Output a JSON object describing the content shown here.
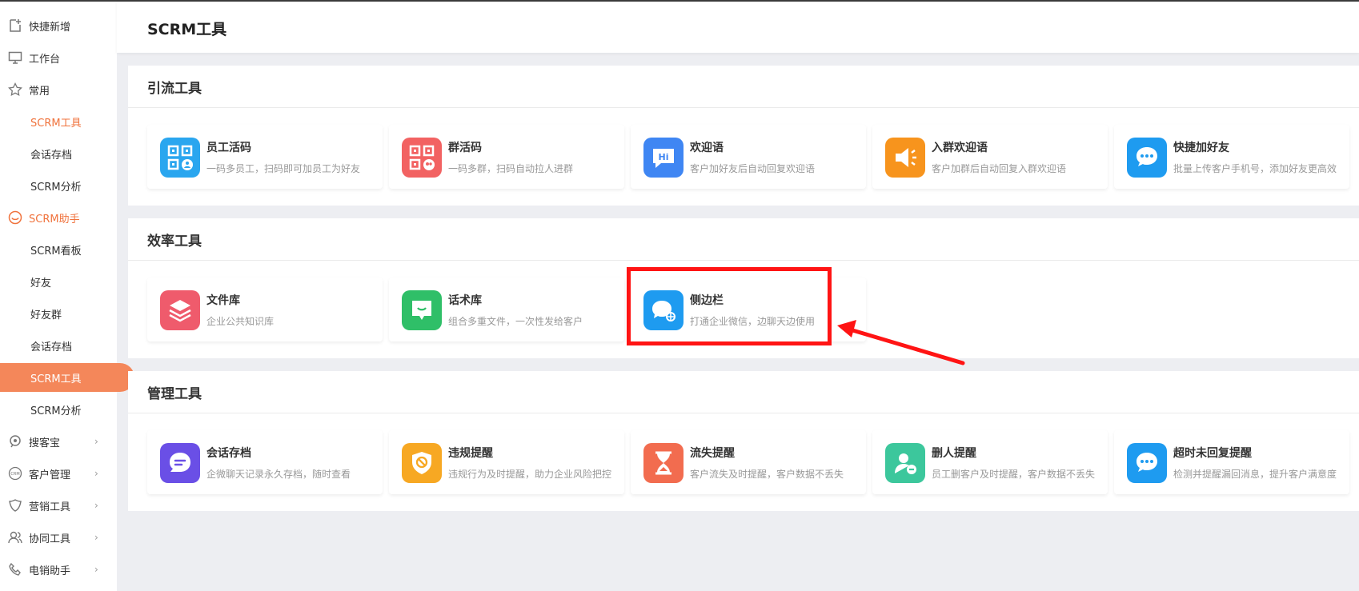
{
  "header": {
    "title": "SCRM工具"
  },
  "sidebar": {
    "items": [
      {
        "label": "快捷新增",
        "icon": "add-doc-icon"
      },
      {
        "label": "工作台",
        "icon": "monitor-icon"
      },
      {
        "label": "常用",
        "icon": "star-icon"
      },
      {
        "label": "SCRM工具"
      },
      {
        "label": "会话存档"
      },
      {
        "label": "SCRM分析"
      },
      {
        "label": "SCRM助手",
        "icon": "smile-icon"
      },
      {
        "label": "SCRM看板"
      },
      {
        "label": "好友"
      },
      {
        "label": "好友群"
      },
      {
        "label": "会话存档"
      },
      {
        "label": "SCRM工具"
      },
      {
        "label": "SCRM分析"
      },
      {
        "label": "搜客宝",
        "icon": "search-gear-icon"
      },
      {
        "label": "客户管理",
        "icon": "crm-icon"
      },
      {
        "label": "营销工具",
        "icon": "shield-heart-icon"
      },
      {
        "label": "协同工具",
        "icon": "users-icon"
      },
      {
        "label": "电销助手",
        "icon": "phone-icon"
      }
    ],
    "arrow": "›"
  },
  "sections": [
    {
      "title": "引流工具",
      "cards": [
        {
          "name": "员工活码",
          "desc": "一码多员工，扫码即可加员工为好友",
          "icon": "qrcode-user-icon",
          "color": "#2aa6ef"
        },
        {
          "name": "群活码",
          "desc": "一码多群，扫码自动拉人进群",
          "icon": "qrcode-group-icon",
          "color": "#f26262"
        },
        {
          "name": "欢迎语",
          "desc": "客户加好友后自动回复欢迎语",
          "icon": "hi-bubble-icon",
          "color": "#3f86f3"
        },
        {
          "name": "入群欢迎语",
          "desc": "客户加群后自动回复入群欢迎语",
          "icon": "megaphone-icon",
          "color": "#f7941d"
        },
        {
          "name": "快捷加好友",
          "desc": "批量上传客户手机号，添加好友更高效",
          "icon": "chat-dots-icon",
          "color": "#1e9bf0"
        }
      ]
    },
    {
      "title": "效率工具",
      "cards": [
        {
          "name": "文件库",
          "desc": "企业公共知识库",
          "icon": "layers-icon",
          "color": "#ef5b6c"
        },
        {
          "name": "话术库",
          "desc": "组合多重文件，一次性发给客户",
          "icon": "smile-chat-icon",
          "color": "#2fbf68"
        },
        {
          "name": "侧边栏",
          "desc": "打通企业微信，边聊天边使用",
          "icon": "chat-sidebar-icon",
          "color": "#1e9bf0"
        }
      ]
    },
    {
      "title": "管理工具",
      "cards": [
        {
          "name": "会话存档",
          "desc": "企微聊天记录永久存档，随时查看",
          "icon": "chat-lines-icon",
          "color": "#6a4fe6"
        },
        {
          "name": "违规提醒",
          "desc": "违规行为及时提醒，助力企业风险把控",
          "icon": "forbid-shield-icon",
          "color": "#f7a823"
        },
        {
          "name": "流失提醒",
          "desc": "客户流失及时提醒，客户数据不丢失",
          "icon": "hourglass-icon",
          "color": "#f26c4f"
        },
        {
          "name": "删人提醒",
          "desc": "员工删客户及时提醒，客户数据不丢失",
          "icon": "user-minus-icon",
          "color": "#3cc79c"
        },
        {
          "name": "超时未回复提醒",
          "desc": "检测并提醒漏回消息，提升客户满意度",
          "icon": "chat-dots-icon",
          "color": "#1e9bf0"
        }
      ]
    }
  ],
  "colors": {
    "accent": "#f4875a",
    "highlight": "#ff1414"
  }
}
